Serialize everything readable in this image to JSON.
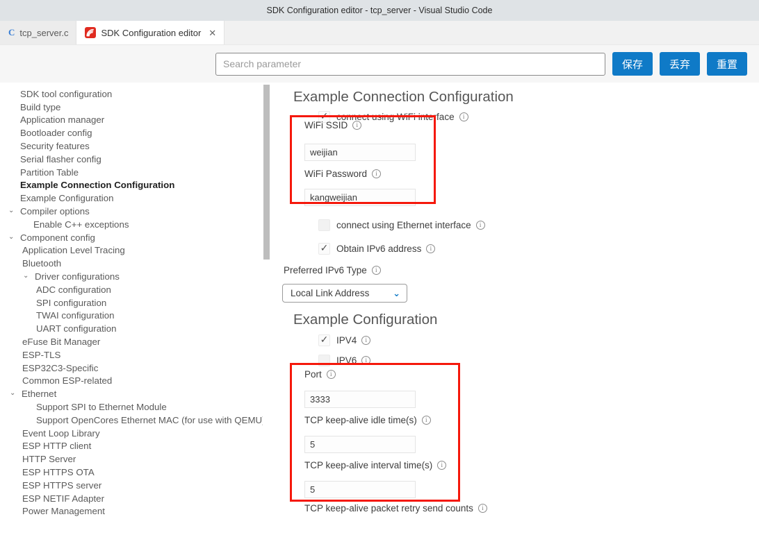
{
  "window": {
    "title": "SDK Configuration editor - tcp_server - Visual Studio Code"
  },
  "tabs": [
    {
      "label": "tcp_server.c",
      "icon": "c-file-icon",
      "active": false,
      "closable": false
    },
    {
      "label": "SDK Configuration editor",
      "icon": "esp-idf-icon",
      "active": true,
      "closable": true,
      "close_label": "✕"
    }
  ],
  "toolbar": {
    "search_placeholder": "Search parameter",
    "search_value": "",
    "save_label": "保存",
    "discard_label": "丢弃",
    "reset_label": "重置",
    "button_color": "#0f7ac7"
  },
  "sidebar": {
    "items": [
      {
        "label": "SDK tool configuration",
        "indent": 0,
        "chevron": "",
        "bold": false
      },
      {
        "label": "Build type",
        "indent": 0,
        "chevron": "",
        "bold": false
      },
      {
        "label": "Application manager",
        "indent": 0,
        "chevron": "",
        "bold": false
      },
      {
        "label": "Bootloader config",
        "indent": 0,
        "chevron": "",
        "bold": false
      },
      {
        "label": "Security features",
        "indent": 0,
        "chevron": "",
        "bold": false
      },
      {
        "label": "Serial flasher config",
        "indent": 0,
        "chevron": "",
        "bold": false
      },
      {
        "label": "Partition Table",
        "indent": 0,
        "chevron": "",
        "bold": false
      },
      {
        "label": "Example Connection Configuration",
        "indent": 0,
        "chevron": "",
        "bold": true
      },
      {
        "label": "Example Configuration",
        "indent": 0,
        "chevron": "",
        "bold": false
      },
      {
        "label": "Compiler options",
        "indent": 0,
        "chevron": "⌄",
        "bold": false
      },
      {
        "label": "Enable C++ exceptions",
        "indent": 1,
        "chevron": "",
        "bold": false
      },
      {
        "label": "Component config",
        "indent": 0,
        "chevron": "⌄",
        "bold": false
      },
      {
        "label": "Application Level Tracing",
        "indent": 1,
        "chevron": "",
        "bold": false
      },
      {
        "label": "Bluetooth",
        "indent": 1,
        "chevron": "",
        "bold": false
      },
      {
        "label": "Driver configurations",
        "indent": 1,
        "chevron": "⌄",
        "bold": false
      },
      {
        "label": "ADC configuration",
        "indent": 2,
        "chevron": "",
        "bold": false
      },
      {
        "label": "SPI configuration",
        "indent": 2,
        "chevron": "",
        "bold": false
      },
      {
        "label": "TWAI configuration",
        "indent": 2,
        "chevron": "",
        "bold": false
      },
      {
        "label": "UART configuration",
        "indent": 2,
        "chevron": "",
        "bold": false
      },
      {
        "label": "eFuse Bit Manager",
        "indent": 1,
        "chevron": "",
        "bold": false
      },
      {
        "label": "ESP-TLS",
        "indent": 1,
        "chevron": "",
        "bold": false
      },
      {
        "label": "ESP32C3-Specific",
        "indent": 1,
        "chevron": "",
        "bold": false
      },
      {
        "label": "Common ESP-related",
        "indent": 1,
        "chevron": "",
        "bold": false
      },
      {
        "label": "Ethernet",
        "indent": 1,
        "chevron": "⌄",
        "bold": false
      },
      {
        "label": "Support SPI to Ethernet Module",
        "indent": 2,
        "chevron": "",
        "bold": false
      },
      {
        "label": "Support OpenCores Ethernet MAC (for use with QEMU)",
        "indent": 2,
        "chevron": "",
        "bold": false
      },
      {
        "label": "Event Loop Library",
        "indent": 1,
        "chevron": "",
        "bold": false
      },
      {
        "label": "ESP HTTP client",
        "indent": 1,
        "chevron": "",
        "bold": false
      },
      {
        "label": "HTTP Server",
        "indent": 1,
        "chevron": "",
        "bold": false
      },
      {
        "label": "ESP HTTPS OTA",
        "indent": 1,
        "chevron": "",
        "bold": false
      },
      {
        "label": "ESP HTTPS server",
        "indent": 1,
        "chevron": "",
        "bold": false
      },
      {
        "label": "ESP NETIF Adapter",
        "indent": 1,
        "chevron": "",
        "bold": false
      },
      {
        "label": "Power Management",
        "indent": 1,
        "chevron": "",
        "bold": false
      }
    ]
  },
  "main": {
    "connection_section": {
      "title": "Example Connection Configuration",
      "wifi_checkbox": {
        "label": "connect using WiFi interface",
        "checked": true,
        "tick": "✓"
      },
      "wifi_ssid": {
        "label": "WiFi SSID",
        "value": "weijian"
      },
      "wifi_password": {
        "label": "WiFi Password",
        "value": "kangweijian"
      },
      "ethernet_checkbox": {
        "label": "connect using Ethernet interface",
        "checked": false,
        "tick": ""
      },
      "ipv6_checkbox": {
        "label": "Obtain IPv6 address",
        "checked": true,
        "tick": "✓"
      },
      "preferred_ipv6": {
        "label": "Preferred IPv6 Type",
        "value": "Local Link Address",
        "chevron": "⌄"
      }
    },
    "example_section": {
      "title": "Example Configuration",
      "ipv4_checkbox": {
        "label": "IPV4",
        "checked": true,
        "tick": "✓"
      },
      "ipv6_checkbox": {
        "label": "IPV6",
        "checked": false,
        "tick": ""
      },
      "port": {
        "label": "Port",
        "value": "3333"
      },
      "keepalive_idle": {
        "label": "TCP keep-alive idle time(s)",
        "value": "5"
      },
      "keepalive_interval": {
        "label": "TCP keep-alive interval time(s)",
        "value": "5"
      },
      "keepalive_retry": {
        "label": "TCP keep-alive packet retry send counts"
      }
    },
    "info_glyph": "i",
    "annotation_color": "#f5180b"
  }
}
